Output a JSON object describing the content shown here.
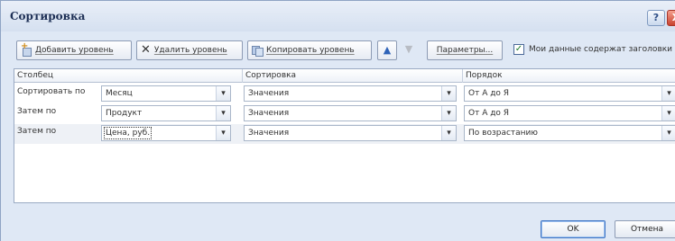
{
  "window": {
    "title": "Сортировка",
    "help_glyph": "?",
    "close_glyph": "X"
  },
  "toolbar": {
    "add_level": "Добавить уровень",
    "delete_level": "Удалить уровень",
    "copy_level": "Копировать уровень",
    "move_up_glyph": "▲",
    "move_down_glyph": "▼",
    "options": "Параметры...",
    "headers_checkbox_label": "Мои данные содержат заголовки",
    "headers_checkbox_checked": true,
    "check_glyph": "✓"
  },
  "grid": {
    "columns": [
      "Столбец",
      "Сортировка",
      "Порядок"
    ],
    "dropdown_glyph": "▾",
    "rows": [
      {
        "label": "Сортировать по",
        "column": "Месяц",
        "sort_on": "Значения",
        "order": "От А до Я"
      },
      {
        "label": "Затем по",
        "column": "Продукт",
        "sort_on": "Значения",
        "order": "От А до Я"
      },
      {
        "label": "Затем по",
        "column": "Цена, руб.",
        "sort_on": "Значения",
        "order": "По возрастанию"
      }
    ]
  },
  "footer": {
    "ok": "OK",
    "cancel": "Отмена"
  },
  "icons": [
    "add-level-icon",
    "delete-icon",
    "copy-icon",
    "move-up-icon",
    "move-down-icon",
    "dropdown-arrow-icon",
    "help-icon",
    "close-icon"
  ],
  "colors": {
    "dialog_bg": "#dfe8f5",
    "title_text": "#1d2f55",
    "close_button": "#c9432f",
    "checkbox_mark": "#1a7a26"
  }
}
